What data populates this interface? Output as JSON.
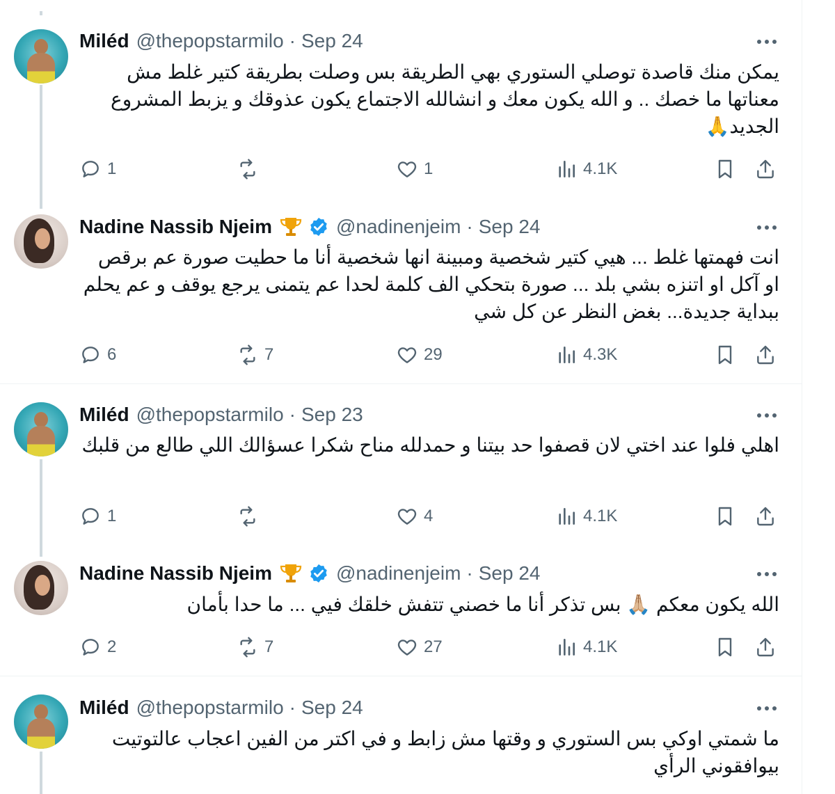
{
  "tweets": [
    {
      "avatar": "avatar-thepopstarmilo",
      "name": "Miléd",
      "handle": "@thepopstarmilo",
      "date": "Sep 24",
      "verified": false,
      "text": "يمكن منك قاصدة توصلي الستوري بهي الطريقة بس وصلت بطريقة كتير غلط مش معناتها ما خصك .. و الله يكون معك و انشالله الاجتماع يكون عذوقك و يزبط المشروع الجديد🙏",
      "replies": "1",
      "reposts": "",
      "likes": "1",
      "views": "4.1K"
    },
    {
      "avatar": "avatar-nadinenjeim",
      "name": "Nadine Nassib Njeim",
      "handle": "@nadinenjeim",
      "date": "Sep 24",
      "verified": true,
      "text": "انت فهمتها غلط ... هيي كتير شخصية ومبينة انها شخصية أنا ما حطيت صورة عم برقص او آكل او اتنزه بشي بلد ... صورة بتحكي الف كلمة لحدا عم يتمنى يرجع يوقف و عم يحلم ببداية جديدة... بغض النظر عن كل شي",
      "replies": "6",
      "reposts": "7",
      "likes": "29",
      "views": "4.3K"
    },
    {
      "avatar": "avatar-thepopstarmilo",
      "name": "Miléd",
      "handle": "@thepopstarmilo",
      "date": "Sep 23",
      "verified": false,
      "text": "اهلي فلوا عند اختي لان قصفوا حد بيتنا و حمدلله مناح شكرا عسؤالك اللي طالع من قلبك",
      "replies": "1",
      "reposts": "",
      "likes": "4",
      "views": "4.1K"
    },
    {
      "avatar": "avatar-nadinenjeim",
      "name": "Nadine Nassib Njeim",
      "handle": "@nadinenjeim",
      "date": "Sep 24",
      "verified": true,
      "text": "الله يكون معكم 🙏🏼 بس تذكر أنا ما خصني تتفش خلقك فيي ... ما حدا بأمان",
      "replies": "2",
      "reposts": "7",
      "likes": "27",
      "views": "4.1K"
    },
    {
      "avatar": "avatar-thepopstarmilo",
      "name": "Miléd",
      "handle": "@thepopstarmilo",
      "date": "Sep 24",
      "verified": false,
      "text": "ما شمتي اوكي بس الستوري و وقتها مش زابط و في اكتر من الفين اعجاب عالتوتيت بيوافقوني الرأي",
      "replies": "",
      "reposts": "",
      "likes": "",
      "views": ""
    }
  ],
  "header_separator": "·",
  "icons": {
    "reply": "reply-icon",
    "repost": "repost-icon",
    "like": "heart-icon",
    "views": "views-icon",
    "bookmark": "bookmark-icon",
    "share": "share-icon",
    "more": "more-icon",
    "verified": "verified-badge-icon",
    "trophy": "trophy-icon"
  },
  "colors": {
    "text": "#0f1419",
    "secondary": "#536471",
    "verified": "#1d9bf0",
    "thread_line": "#cfd9de",
    "divider": "#eff3f4"
  }
}
